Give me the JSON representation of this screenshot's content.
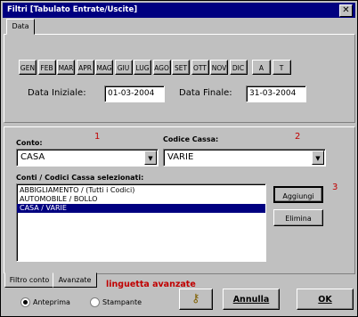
{
  "window": {
    "title": "Filtri  [Tabulato Entrate/Uscite]",
    "close_glyph": "✕"
  },
  "tabs_top": [
    "Data"
  ],
  "months": [
    "GEN",
    "FEB",
    "MAR",
    "APR",
    "MAG",
    "GIU",
    "LUG",
    "AGO",
    "SET",
    "OTT",
    "NOV",
    "DIC",
    "A",
    "T"
  ],
  "dates": {
    "start_label": "Data Iniziale:",
    "start_value": "01-03-2004",
    "end_label": "Data Finale:",
    "end_value": "31-03-2004"
  },
  "filters": {
    "conto_label": "Conto:",
    "conto_value": "CASA",
    "marker_1": "1",
    "codice_label": "Codice Cassa:",
    "codice_value": "VARIE",
    "marker_2": "2",
    "list_label": "Conti / Codici Cassa selezionati:",
    "marker_3": "3",
    "list_items": [
      "ABBIGLIAMENTO / (Tutti i Codici)",
      "AUTOMOBILE / BOLLO",
      "CASA / VARIE"
    ],
    "selected_index": 2,
    "aggiungi_label": "Aggiungi",
    "elimina_label": "Elimina"
  },
  "bottom_tabs": {
    "tab1": "Filtro conto",
    "tab2": "Avanzate",
    "annotation": "linguetta avanzate"
  },
  "footer": {
    "radio1": "Anteprima",
    "radio2": "Stampante",
    "help_icon": "key-icon",
    "annulla": "Annulla",
    "ok": "OK"
  }
}
